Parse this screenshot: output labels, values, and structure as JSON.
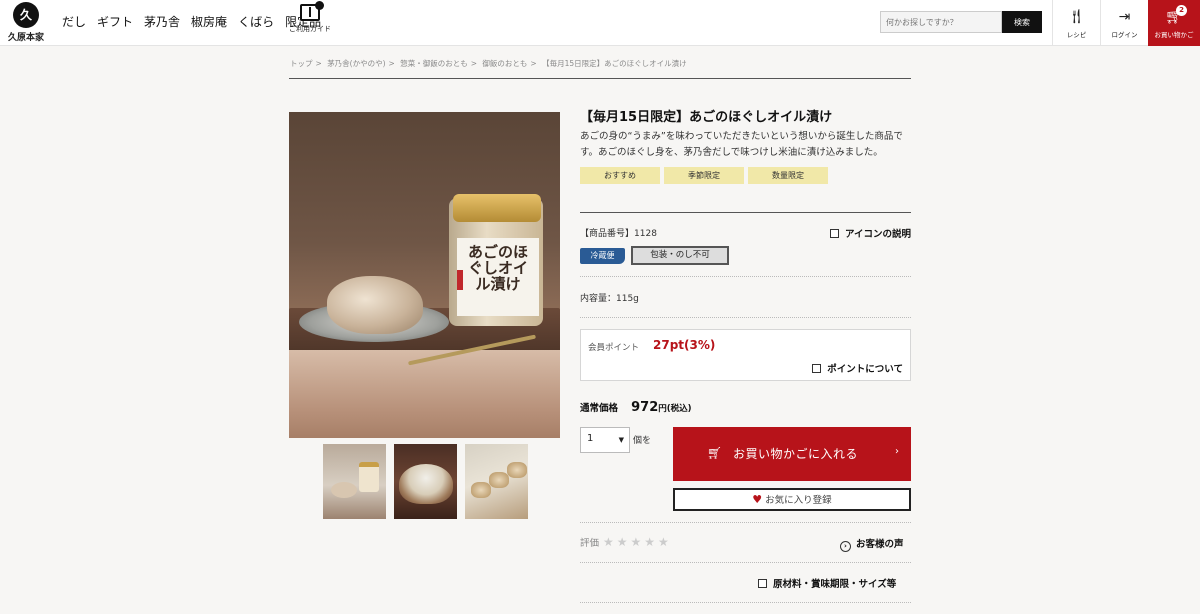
{
  "brand": {
    "logo_text": "久原本家",
    "logo_mark": "久"
  },
  "nav": {
    "items": [
      "だし",
      "ギフト",
      "茅乃舎",
      "椒房庵",
      "くばら",
      "限定品"
    ]
  },
  "guide": {
    "label": "ご利用ガイド"
  },
  "search": {
    "placeholder": "何かお探しですか？",
    "button": "検索"
  },
  "header_buttons": {
    "recipe": "レシピ",
    "login": "ログイン",
    "cart": "お買い物かご",
    "cart_count": "2"
  },
  "breadcrumb": [
    "トップ",
    "茅乃舎(かやのや)",
    "惣菜・御飯のおとも",
    "御飯のおとも",
    "【毎月15日限定】あごのほぐしオイル漬け"
  ],
  "product": {
    "title": "【毎月15日限定】あごのほぐしオイル漬け",
    "description": "あごの身の“うまみ”を味わっていただきたいという想いから誕生した商品です。あごのほぐし身を、茅乃舎だしで味つけし米油に漬け込みました。",
    "tags": [
      "おすすめ",
      "季節限定",
      "数量限定"
    ],
    "code_label": "【商品番号】",
    "code": "1128",
    "icon_help": "アイコンの説明",
    "badge_cold": "冷蔵便",
    "badge_wrap": "包装・のし不可",
    "volume": "内容量：115g",
    "jar_label": "あごのほぐしオイル漬け"
  },
  "points": {
    "label": "会員ポイント",
    "value": "27pt(3%)",
    "about": "ポイントについて"
  },
  "price": {
    "label": "通常価格",
    "value": "972",
    "unit": "円(税込)"
  },
  "purchase": {
    "quantity": "1",
    "quantity_unit": "個を",
    "add_to_cart": "お買い物かごに入れる",
    "favorite": "お気に入り登録"
  },
  "review": {
    "label": "評価",
    "stars": "★★★★★",
    "voices": "お客様の声",
    "rating": 0
  },
  "spec": {
    "label": "原材料・賞味期限・サイズ等"
  },
  "colors": {
    "accent": "#b7131a",
    "tag_bg": "#f1e8a8",
    "cold_badge": "#2a5b95"
  }
}
